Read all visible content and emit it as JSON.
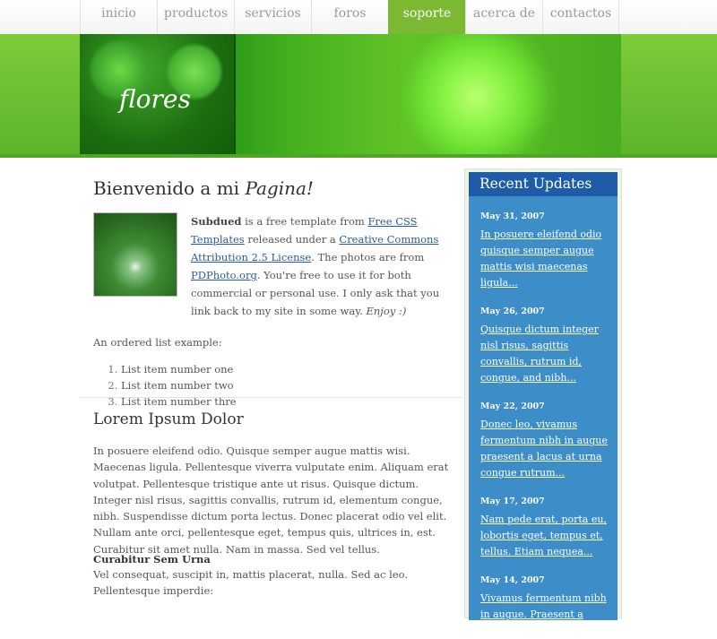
{
  "nav": {
    "items": [
      "inicio",
      "productos",
      "servicios",
      "foros",
      "soporte",
      "acerca de",
      "contactos"
    ],
    "active_index": 4
  },
  "banner": {
    "title": "flores"
  },
  "main": {
    "heading_prefix": "Bienvenido a mi ",
    "heading_em": "Pagina!",
    "intro": {
      "brand": "Subdued",
      "t1": " is a free template from ",
      "link1": "Free CSS Templates",
      "t2": " released under a ",
      "link2": "Creative Commons Attribution 2.5 License",
      "t3": ". The photos are from ",
      "link3": "PDPhoto.org",
      "t4": ". You're free to use it for both commercial or personal use. I only ask that you link back to my site in some way. ",
      "enjoy": "Enjoy :)"
    },
    "ordered_label": "An ordered list example:",
    "list": [
      "List item number one",
      "List item number two",
      "List item number thre"
    ],
    "section2": {
      "heading": "Lorem Ipsum Dolor",
      "paragraph": "In posuere eleifend odio. Quisque semper augue mattis wisi. Maecenas ligula. Pellentesque viverra vulputate enim. Aliquam erat volutpat. Pellentesque tristique ante ut risus. Quisque dictum. Integer nisl risus, sagittis convallis, rutrum id, elementum congue, nibh. Suspendisse dictum porta lectus. Donec placerat odio vel elit. Nullam ante orci, pellentesque eget, tempus quis, ultrices in, est. Curabitur sit amet nulla. Nam in massa. Sed vel tellus.",
      "subheading": "Curabitur Sem Urna",
      "paragraph2": "Vel consequat, suscipit in, mattis placerat, nulla. Sed ac leo. Pellentesque imperdie:"
    }
  },
  "sidebar": {
    "title": "Recent Updates",
    "entries": [
      {
        "date": "May 31, 2007",
        "text": "In posuere eleifend odio quisque semper augue mattis wisi maecenas ligula..."
      },
      {
        "date": "May 26, 2007",
        "text": "Quisque dictum integer nisl risus, sagittis convallis, rutrum id, congue, and nibh..."
      },
      {
        "date": "May 22, 2007",
        "text": "Donec leo, vivamus fermentum nibh in augue praesent a lacus at urna congue rutrum..."
      },
      {
        "date": "May 17, 2007",
        "text": "Nam pede erat, porta eu, lobortis eget, tempus et, tellus. Etiam nequea..."
      },
      {
        "date": "May 14, 2007",
        "text": "Vivamus fermentum nibh in augue. Praesent a lacus at"
      }
    ]
  },
  "colors": {
    "nav_active": "#7cb933",
    "banner_green": "#5eb32a",
    "sidebar_blue": "#3d8ec8",
    "sidebar_head": "#1e5ca8",
    "link": "#2a57a8"
  }
}
